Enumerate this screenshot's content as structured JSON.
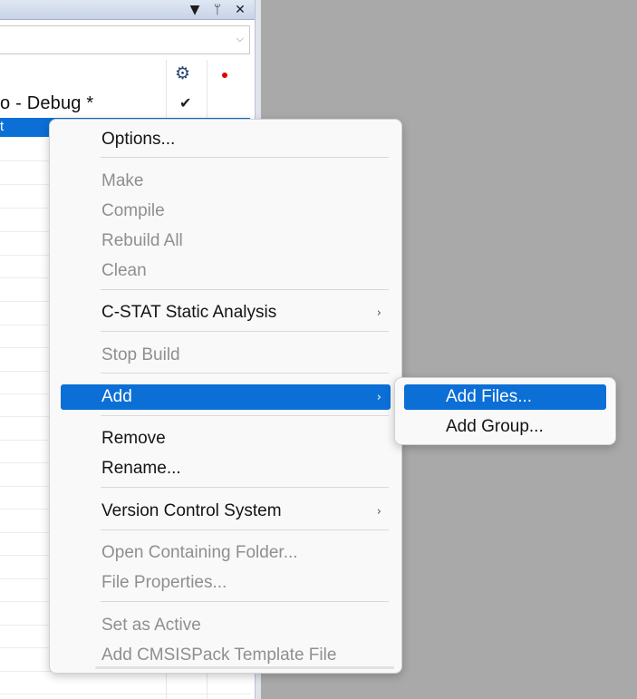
{
  "panel": {
    "titlebar_buttons": {
      "dropdown_glyph": "▼",
      "pin_glyph": "ᛘ",
      "close_glyph": "✕"
    },
    "combo_arrow_glyph": "⌵",
    "gear_glyph": "⚙",
    "check_glyph": "✔",
    "project_name": "o - Debug *",
    "selected_row_text": "t"
  },
  "context_menu": {
    "items": [
      {
        "label": "Options...",
        "enabled": true
      },
      {
        "label": "Make",
        "enabled": false
      },
      {
        "label": "Compile",
        "enabled": false
      },
      {
        "label": "Rebuild All",
        "enabled": false
      },
      {
        "label": "Clean",
        "enabled": false
      },
      {
        "label": "C-STAT Static Analysis",
        "enabled": true,
        "has_submenu": true
      },
      {
        "label": "Stop Build",
        "enabled": false
      },
      {
        "label": "Add",
        "enabled": true,
        "has_submenu": true,
        "highlighted": true
      },
      {
        "label": "Remove",
        "enabled": true
      },
      {
        "label": "Rename...",
        "enabled": true
      },
      {
        "label": "Version Control System",
        "enabled": true,
        "has_submenu": true
      },
      {
        "label": "Open Containing Folder...",
        "enabled": false
      },
      {
        "label": "File Properties...",
        "enabled": false
      },
      {
        "label": "Set as Active",
        "enabled": false
      },
      {
        "label": "Add CMSISPack Template File",
        "enabled": false
      }
    ],
    "submenu_arrow_glyph": "›"
  },
  "add_submenu": {
    "items": [
      {
        "label": "Add Files...",
        "highlighted": true
      },
      {
        "label": "Add Group...",
        "highlighted": false
      }
    ]
  },
  "colors": {
    "highlight": "#0b6fd6",
    "disabled_text": "#8f8f8f",
    "menu_background": "#f9f9f9",
    "desktop_background": "#a9a9a9"
  }
}
